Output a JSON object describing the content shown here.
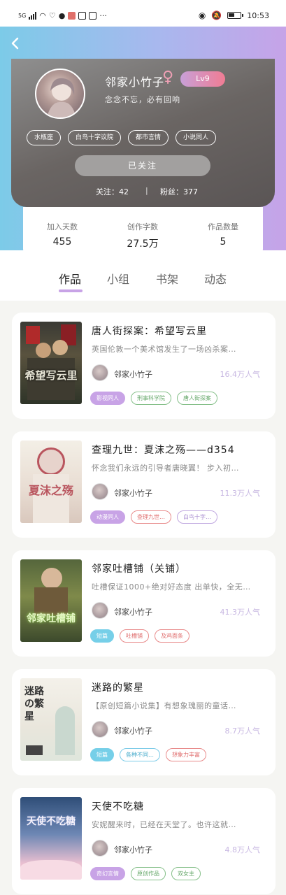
{
  "status_bar": {
    "network": "5G",
    "time": "10:53",
    "more": "···"
  },
  "profile": {
    "nickname": "邻家小竹子",
    "gender_symbol": "♀",
    "level": "Lv9",
    "bio": "念念不忘，必有回响",
    "tags": [
      "水瓶座",
      "白鸟十字议院",
      "都市言情",
      "小说同人"
    ],
    "follow_button": "已关注",
    "following": "关注：42",
    "fans": "粉丝：377",
    "divider": "|"
  },
  "stats": {
    "days_label": "加入天数",
    "days_value": "455",
    "words_label": "创作字数",
    "words_value": "27.5万",
    "works_label": "作品数量",
    "works_value": "5"
  },
  "tabs": [
    "作品",
    "小组",
    "书架",
    "动态"
  ],
  "active_tab": "作品",
  "works": [
    {
      "title": "唐人街探案：希望写云里",
      "desc": "英国伦敦一个美术馆发生了一场凶杀案…",
      "author": "邻家小竹子",
      "popularity": "16.4万人气",
      "cover_text": "希望写云里",
      "tags": [
        {
          "label": "影视同人",
          "style": "purple-fill"
        },
        {
          "label": "刑事科学院",
          "style": "green"
        },
        {
          "label": "唐人街探案",
          "style": "green"
        }
      ]
    },
    {
      "title": "查理九世：夏沫之殇——d354",
      "desc": "怀念我们永远的引导者唐晓翼！ 步入初…",
      "author": "邻家小竹子",
      "popularity": "11.3万人气",
      "cover_text": "夏沫之殇",
      "tags": [
        {
          "label": "动漫同人",
          "style": "purple-fill"
        },
        {
          "label": "查理九世…",
          "style": "red"
        },
        {
          "label": "白鸟十字…",
          "style": "purple"
        }
      ]
    },
    {
      "title": "邻家吐槽铺（关铺）",
      "desc": "吐槽保证1000+绝对好态度 出单快，全无…",
      "author": "邻家小竹子",
      "popularity": "41.3万人气",
      "cover_text": "邻家吐槽铺",
      "tags": [
        {
          "label": "短篇",
          "style": "blue-fill"
        },
        {
          "label": "吐槽铺",
          "style": "red"
        },
        {
          "label": "及鸡面条",
          "style": "red"
        }
      ]
    },
    {
      "title": "迷路的繁星",
      "desc": "【原创短篇小说集】有想象瑰丽的童话…",
      "author": "邻家小竹子",
      "popularity": "8.7万人气",
      "cover_text": "迷路の繁星",
      "tags": [
        {
          "label": "短篇",
          "style": "blue-fill"
        },
        {
          "label": "各种不同…",
          "style": "cyan"
        },
        {
          "label": "想象力丰富",
          "style": "red"
        }
      ]
    },
    {
      "title": "天使不吃糖",
      "desc": "安妮醒来时，已经在天堂了。也许这就…",
      "author": "邻家小竹子",
      "popularity": "4.8万人气",
      "cover_text": "天使不吃糖",
      "tags": [
        {
          "label": "奇幻言情",
          "style": "purple-fill"
        },
        {
          "label": "原创作品",
          "style": "green"
        },
        {
          "label": "双女主",
          "style": "green"
        }
      ]
    }
  ],
  "colors": {
    "header_gradient_start": "#7ccbe8",
    "header_gradient_end": "#c6a3e8",
    "accent_purple": "#c8a3e6",
    "accent_blue": "#76cfe8"
  }
}
